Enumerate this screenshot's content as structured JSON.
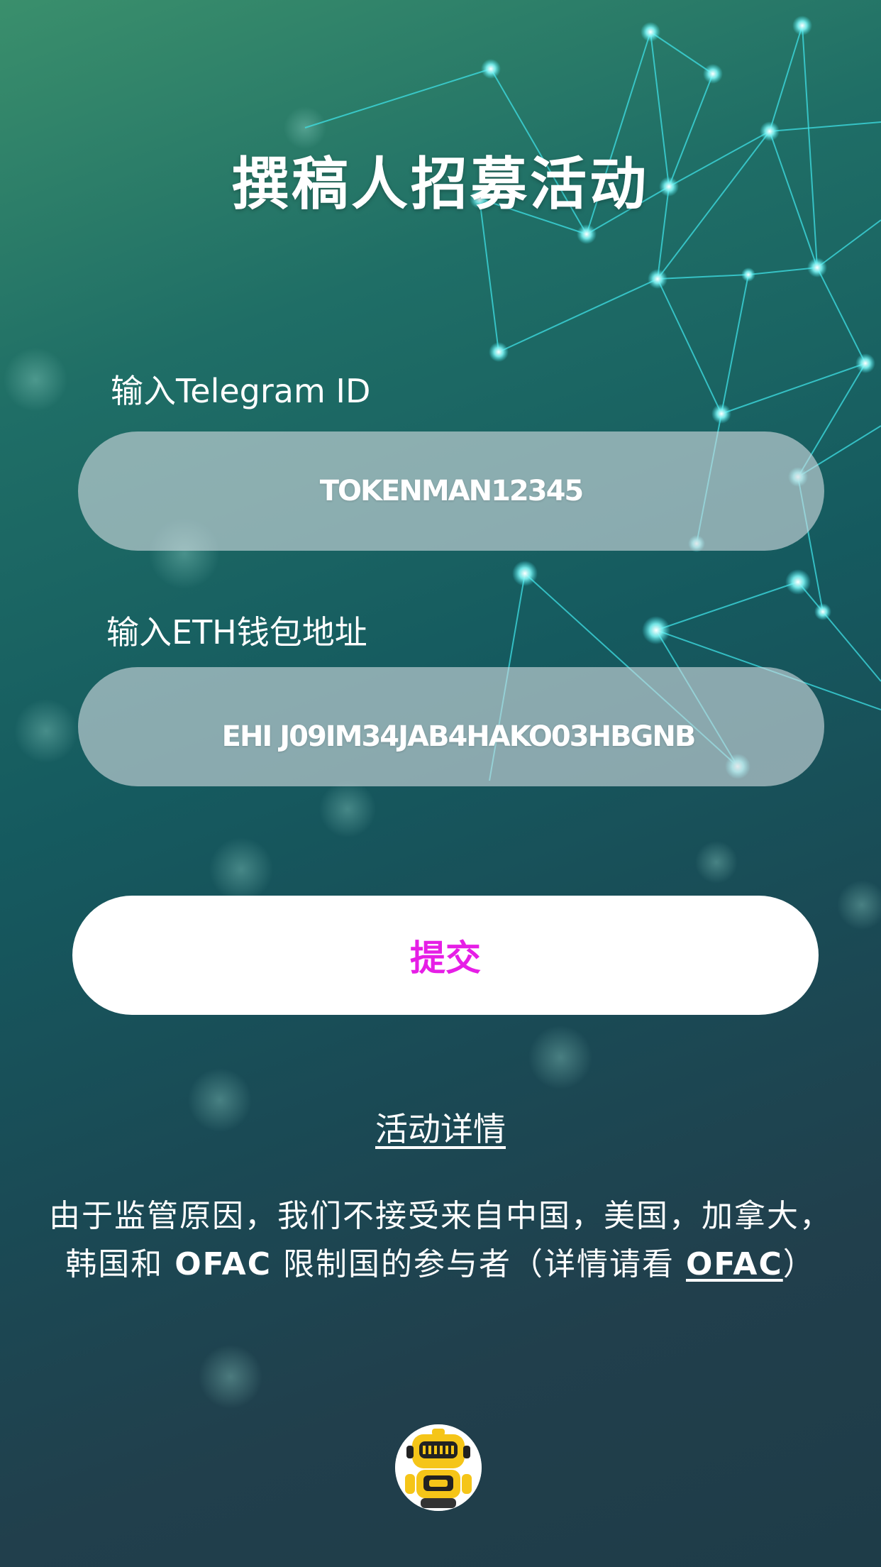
{
  "page": {
    "title": "撰稿人招募活动"
  },
  "form": {
    "telegram": {
      "label": "输入Telegram ID",
      "value": "TOKENMAN12345"
    },
    "eth": {
      "label": "输入ETH钱包地址",
      "value": "EHI J09IM34JAB4HAKO03HBGNB"
    },
    "submit_label": "提交"
  },
  "details": {
    "link_label": "活动详情",
    "notice_part1": "由于监管原因，我们不接受来自中国，美国，加拿大，",
    "notice_part2": "韩国和 ",
    "notice_ofac1": "OFAC",
    "notice_part3": " 限制国的参与者（详情请看 ",
    "notice_ofac_link": "OFAC",
    "notice_part4": "）"
  },
  "icons": {
    "avatar": "robot-mascot-icon"
  },
  "colors": {
    "accent": "#e61ee6",
    "network_lines": "#3fe0e6"
  }
}
